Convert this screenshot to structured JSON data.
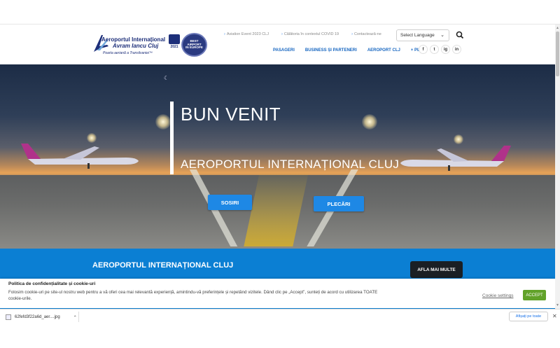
{
  "header": {
    "logo": {
      "line1": "Aeroportul Internațional",
      "line2": "Avram Iancu Cluj",
      "tagline": "Poarta aeriană a Transilvaniei™"
    },
    "award_aci_year": "2021",
    "award_best": [
      "BEST",
      "AIRPORT",
      "IN EUROPE"
    ],
    "top_links": [
      "Aviation Event 2023 CLJ",
      "Călătoria în contextul COVID 19",
      "Contactează-ne"
    ],
    "language_select": "Select Language",
    "nav": [
      "PASAGERI",
      "BUSINESS ȘI PARTENERI",
      "AEROPORT CLJ",
      "+ PLUS"
    ],
    "social": [
      "f",
      "t",
      "ig",
      "in"
    ]
  },
  "hero": {
    "title": "BUN VENIT",
    "subtitle": "AEROPORTUL INTERNAȚIONAL CLUJ",
    "btn_arrivals": "SOSIRI",
    "btn_departures": "PLECĂRI"
  },
  "band": {
    "title": "AEROPORTUL INTERNAȚIONAL CLUJ",
    "button": "AFLA MAI MULTE"
  },
  "cookie": {
    "title": "Politica de confidențialitate și cookie-uri",
    "body": "Folosim cookie-uri pe site-ul nostru web pentru a vă oferi cea mai relevantă experiență, amintindu-vă preferințele și repetând vizitele. Dând clic pe „Accept”, sunteți de acord cu utilizarea TOATE cookie-urile.",
    "settings": "Cookie settings",
    "accept": "ACCEPT"
  },
  "downloads": {
    "file": "62fefd3f22a6d_aer....jpg",
    "show_all": "Afișați pe toate"
  },
  "colors": {
    "brand_blue": "#0b7fd3",
    "button_blue": "#1e88e5",
    "nav_blue": "#1565c0",
    "accept_green": "#61a229"
  }
}
